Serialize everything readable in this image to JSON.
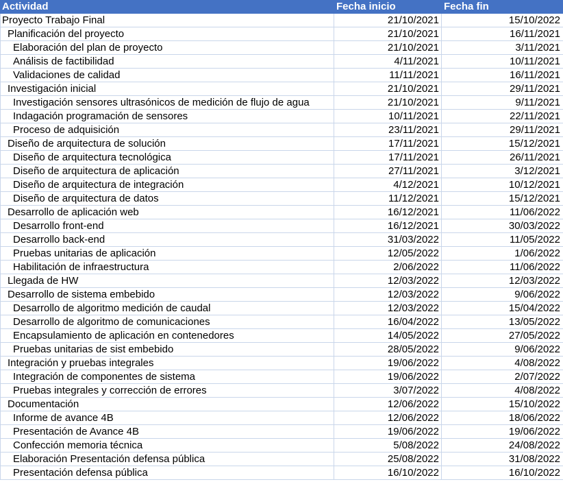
{
  "table": {
    "headers": {
      "activity": "Actividad",
      "start": "Fecha inicio",
      "end": "Fecha fin"
    },
    "rows": [
      {
        "activity": "Proyecto Trabajo Final",
        "start": "21/10/2021",
        "end": "15/10/2022",
        "level": 0
      },
      {
        "activity": "Planificación del proyecto",
        "start": "21/10/2021",
        "end": "16/11/2021",
        "level": 1
      },
      {
        "activity": "Elaboración del plan de proyecto",
        "start": "21/10/2021",
        "end": "3/11/2021",
        "level": 2
      },
      {
        "activity": "Análisis de factibilidad",
        "start": "4/11/2021",
        "end": "10/11/2021",
        "level": 2
      },
      {
        "activity": "Validaciones de calidad",
        "start": "11/11/2021",
        "end": "16/11/2021",
        "level": 2
      },
      {
        "activity": "Investigación inicial",
        "start": "21/10/2021",
        "end": "29/11/2021",
        "level": 1
      },
      {
        "activity": "Investigación sensores ultrasónicos de medición de flujo de agua",
        "start": "21/10/2021",
        "end": "9/11/2021",
        "level": 2
      },
      {
        "activity": "Indagación programación de sensores",
        "start": "10/11/2021",
        "end": "22/11/2021",
        "level": 2
      },
      {
        "activity": "Proceso de adquisición",
        "start": "23/11/2021",
        "end": "29/11/2021",
        "level": 2
      },
      {
        "activity": "Diseño de arquitectura de solución",
        "start": "17/11/2021",
        "end": "15/12/2021",
        "level": 1
      },
      {
        "activity": "Diseño de arquitectura tecnológica",
        "start": "17/11/2021",
        "end": "26/11/2021",
        "level": 2
      },
      {
        "activity": "Diseño de arquitectura de aplicación",
        "start": "27/11/2021",
        "end": "3/12/2021",
        "level": 2
      },
      {
        "activity": "Diseño de arquitectura de integración",
        "start": "4/12/2021",
        "end": "10/12/2021",
        "level": 2
      },
      {
        "activity": "Diseño de arquitectura de datos",
        "start": "11/12/2021",
        "end": "15/12/2021",
        "level": 2
      },
      {
        "activity": "Desarrollo de aplicación web",
        "start": "16/12/2021",
        "end": "11/06/2022",
        "level": 1
      },
      {
        "activity": "Desarrollo front-end",
        "start": "16/12/2021",
        "end": "30/03/2022",
        "level": 2
      },
      {
        "activity": "Desarrollo back-end",
        "start": "31/03/2022",
        "end": "11/05/2022",
        "level": 2
      },
      {
        "activity": "Pruebas unitarias de aplicación",
        "start": "12/05/2022",
        "end": "1/06/2022",
        "level": 2
      },
      {
        "activity": "Habilitación de infraestructura",
        "start": "2/06/2022",
        "end": "11/06/2022",
        "level": 2
      },
      {
        "activity": "Llegada de HW",
        "start": "12/03/2022",
        "end": "12/03/2022",
        "level": 1
      },
      {
        "activity": "Desarrollo de sistema embebido",
        "start": "12/03/2022",
        "end": "9/06/2022",
        "level": 1
      },
      {
        "activity": "Desarrollo de algoritmo medición de caudal",
        "start": "12/03/2022",
        "end": "15/04/2022",
        "level": 2
      },
      {
        "activity": "Desarrollo de algoritmo de comunicaciones",
        "start": "16/04/2022",
        "end": "13/05/2022",
        "level": 2
      },
      {
        "activity": "Encapsulamiento de aplicación en contenedores",
        "start": "14/05/2022",
        "end": "27/05/2022",
        "level": 2
      },
      {
        "activity": "Pruebas unitarias de sist embebido",
        "start": "28/05/2022",
        "end": "9/06/2022",
        "level": 2
      },
      {
        "activity": "Integración y pruebas integrales",
        "start": "19/06/2022",
        "end": "4/08/2022",
        "level": 1
      },
      {
        "activity": "Integración de componentes de sistema",
        "start": "19/06/2022",
        "end": "2/07/2022",
        "level": 2
      },
      {
        "activity": "Pruebas integrales y corrección de errores",
        "start": "3/07/2022",
        "end": "4/08/2022",
        "level": 2
      },
      {
        "activity": "Documentación",
        "start": "12/06/2022",
        "end": "15/10/2022",
        "level": 1
      },
      {
        "activity": "Informe de avance 4B",
        "start": "12/06/2022",
        "end": "18/06/2022",
        "level": 2
      },
      {
        "activity": "Presentación de Avance 4B",
        "start": "19/06/2022",
        "end": "19/06/2022",
        "level": 2
      },
      {
        "activity": "Confección memoria técnica",
        "start": "5/08/2022",
        "end": "24/08/2022",
        "level": 2
      },
      {
        "activity": "Elaboración Presentación defensa pública",
        "start": "25/08/2022",
        "end": "31/08/2022",
        "level": 2
      },
      {
        "activity": "Presentación defensa pública",
        "start": "16/10/2022",
        "end": "16/10/2022",
        "level": 2
      }
    ]
  },
  "colors": {
    "header_bg": "#4472c4",
    "header_text": "#ffffff",
    "grid_line": "#c9d6ea"
  }
}
